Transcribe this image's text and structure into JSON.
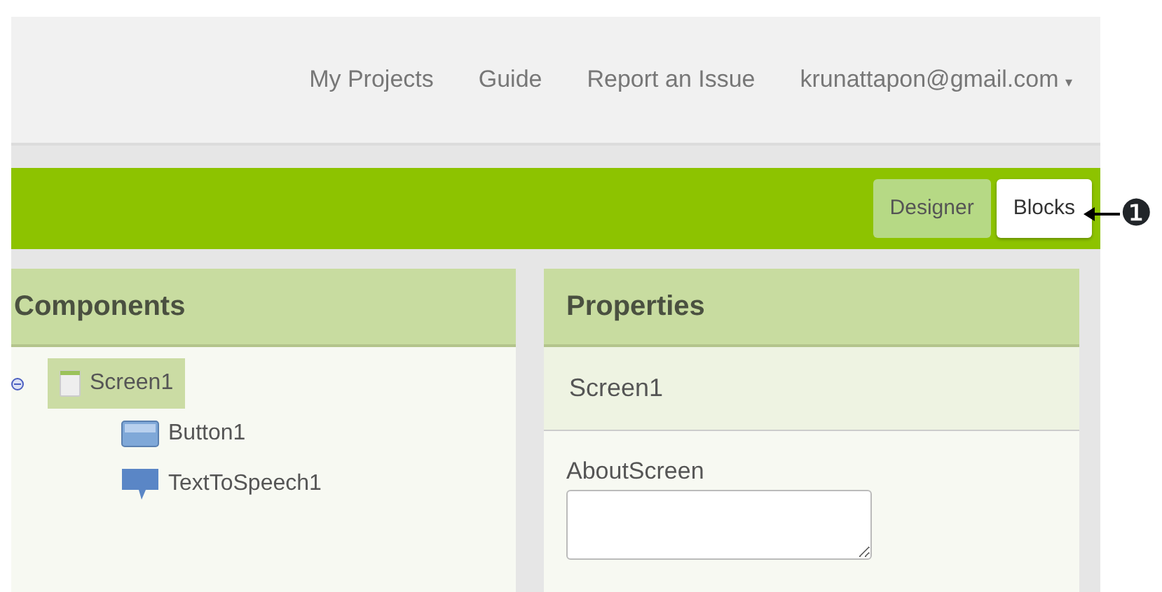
{
  "top_nav": {
    "links": [
      "My Projects",
      "Guide",
      "Report an Issue"
    ],
    "account": "krunattapon@gmail.com",
    "account_caret": "▾"
  },
  "toolbar": {
    "buttons": [
      {
        "label": "Designer",
        "selected": false
      },
      {
        "label": "Blocks",
        "selected": true
      }
    ]
  },
  "annotation": {
    "marker": "❶"
  },
  "components": {
    "title": "Components",
    "tree": [
      {
        "label": "Screen1",
        "kind": "screen",
        "expanded": true,
        "selected": true,
        "children": [
          {
            "label": "Button1",
            "kind": "button",
            "selected": false
          },
          {
            "label": "TextToSpeech1",
            "kind": "speech",
            "selected": false
          }
        ]
      }
    ]
  },
  "properties": {
    "title": "Properties",
    "component": "Screen1",
    "fields": [
      {
        "label": "AboutScreen"
      }
    ]
  }
}
